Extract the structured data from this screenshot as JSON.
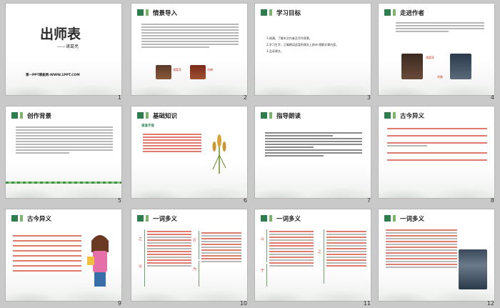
{
  "slides": [
    {
      "num": "1",
      "title": "出师表",
      "subtitle": "——诸葛亮",
      "footer": "第一PPT模板网-WWW.1PPT.COM"
    },
    {
      "num": "2",
      "title": "情景导入",
      "portrait_labels": [
        "诸葛亮",
        "刘禅"
      ]
    },
    {
      "num": "3",
      "title": "学习目标",
      "items": [
        "1.疏通，了解本文作者及写作背景。",
        "2.学习生字，正确朗读此类的课文上前诗 理解文章内容。",
        "3.品读课文。"
      ]
    },
    {
      "num": "4",
      "title": "走进作者",
      "portrait_labels": [
        "诸葛亮",
        "刘备"
      ]
    },
    {
      "num": "5",
      "title": "创作背景"
    },
    {
      "num": "6",
      "title": "基础知识",
      "sub": "读准字音"
    },
    {
      "num": "7",
      "title": "指导朗读"
    },
    {
      "num": "8",
      "title": "古今异义"
    },
    {
      "num": "9",
      "title": "古今异义"
    },
    {
      "num": "10",
      "title": "一词多义",
      "words": [
        "之",
        "行",
        "以",
        "为"
      ]
    },
    {
      "num": "11",
      "title": "一词多义",
      "words": [
        "以",
        "于",
        "之"
      ]
    },
    {
      "num": "12",
      "title": "一词多义"
    }
  ],
  "colors": {
    "accent": "#2e7d4f",
    "highlight": "#e05050",
    "light_green": "#7db36b"
  }
}
